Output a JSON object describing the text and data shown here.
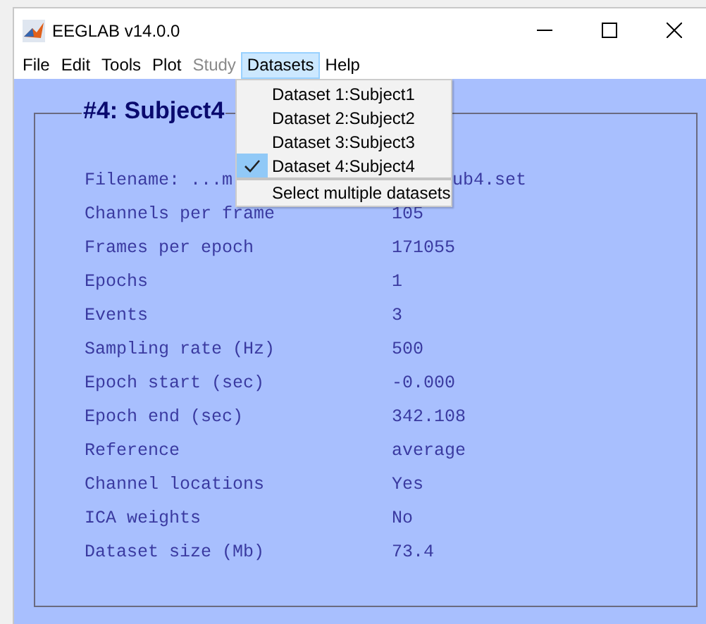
{
  "window": {
    "title": "EEGLAB v14.0.0"
  },
  "menu": [
    {
      "label": "File",
      "disabled": false,
      "selected": false
    },
    {
      "label": "Edit",
      "disabled": false,
      "selected": false
    },
    {
      "label": "Tools",
      "disabled": false,
      "selected": false
    },
    {
      "label": "Plot",
      "disabled": false,
      "selected": false
    },
    {
      "label": "Study",
      "disabled": true,
      "selected": false
    },
    {
      "label": "Datasets",
      "disabled": false,
      "selected": true
    },
    {
      "label": "Help",
      "disabled": false,
      "selected": false
    }
  ],
  "dropdown": [
    {
      "label": "Dataset 1:Subject1",
      "checked": false,
      "separator": false
    },
    {
      "label": "Dataset 2:Subject2",
      "checked": false,
      "separator": false
    },
    {
      "label": "Dataset 3:Subject3",
      "checked": false,
      "separator": false
    },
    {
      "label": "Dataset 4:Subject4",
      "checked": true,
      "separator": false
    },
    {
      "label": "Select multiple datasets",
      "checked": false,
      "separator": true
    }
  ],
  "panel": {
    "title": "#4: Subject4",
    "rows": [
      {
        "label": "Filename: ...m",
        "value": "ub4.set",
        "kind": "covered"
      },
      {
        "label": "Channels per frame",
        "value": "105",
        "kind": "plain"
      },
      {
        "label": "Frames per epoch",
        "value": "171055"
      },
      {
        "label": "Epochs",
        "value": "1"
      },
      {
        "label": "Events",
        "value": "3"
      },
      {
        "label": "Sampling rate (Hz)",
        "value": "500"
      },
      {
        "label": "Epoch start (sec)",
        "value": "-0.000"
      },
      {
        "label": "Epoch end (sec)",
        "value": "342.108"
      },
      {
        "label": "Reference",
        "value": "average"
      },
      {
        "label": "Channel locations",
        "value": "Yes"
      },
      {
        "label": "ICA weights",
        "value": "No"
      },
      {
        "label": "Dataset size (Mb)",
        "value": "73.4"
      }
    ]
  }
}
